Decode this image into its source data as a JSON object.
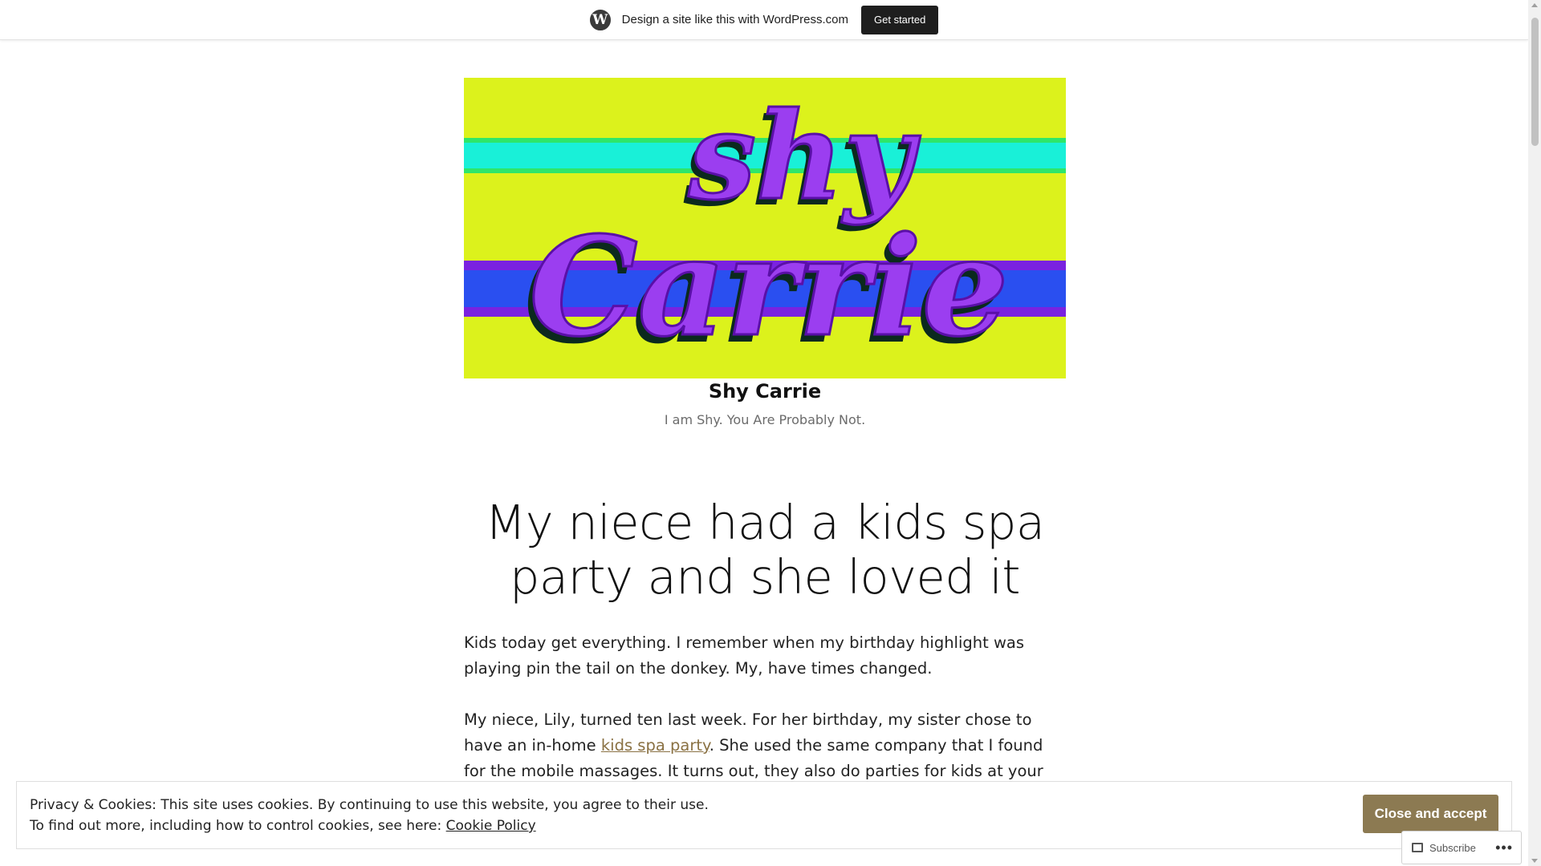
{
  "wp_bar": {
    "logo_glyph": "W",
    "promo_text": "Design a site like this with WordPress.com",
    "cta_label": "Get started"
  },
  "header": {
    "logo_text_top": "shy",
    "logo_text_bottom": "Carrie",
    "site_title": "Shy Carrie",
    "tagline": "I am Shy. You Are Probably Not."
  },
  "post": {
    "title": "My niece had a kids spa party and she loved it",
    "p1": "Kids today get everything. I remember when my birthday highlight was playing pin the tail on the donkey. My, have times changed.",
    "p2_before": "My niece, Lily, turned ten last week. For her birthday, my sister chose to have an in-home ",
    "p2_link": "kids spa party",
    "p2_after": ". She used the same company that I found for the mobile massages. It turns out, they also do parties for kids at your location. A strange"
  },
  "cookie_banner": {
    "line1": "Privacy & Cookies: This site uses cookies. By continuing to use this website, you agree to their use.",
    "line2_prefix": "To find out more, including how to control cookies, see here: ",
    "policy_link": "Cookie Policy",
    "accept_label": "Close and accept"
  },
  "subscribe_widget": {
    "label": "Subscribe",
    "more_glyph": "•••"
  },
  "colors": {
    "accent_button": "#8c7a52",
    "link": "#8a7143",
    "header_bg_yellow": "#dcf21c",
    "stripe_cyan": "#19f0d8",
    "stripe_blue": "#2a4ff0",
    "stripe_purple": "#7a22e0",
    "logo_purple": "#9b3ef0"
  }
}
